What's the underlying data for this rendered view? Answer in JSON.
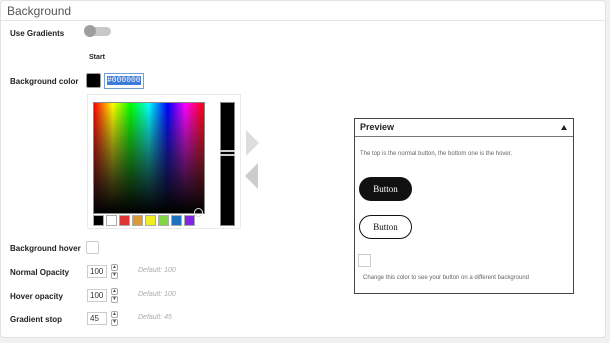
{
  "section": {
    "title": "Background"
  },
  "use_gradients": {
    "label": "Use Gradients",
    "enabled": false
  },
  "start_label": "Start",
  "background_color": {
    "label": "Background color",
    "hex": "#000000",
    "swatch_color": "#000000"
  },
  "color_picker": {
    "palette": [
      "#000000",
      "#ffffff",
      "#dd3333",
      "#dd9933",
      "#eeee22",
      "#81d742",
      "#1e73be",
      "#8224e3"
    ]
  },
  "background_hover": {
    "label": "Background hover"
  },
  "normal_opacity": {
    "label": "Normal Opacity",
    "value": "100",
    "default_hint": "Default: 100"
  },
  "hover_opacity": {
    "label": "Hover opacity",
    "value": "100",
    "default_hint": "Default: 100"
  },
  "gradient_stop": {
    "label": "Gradient stop",
    "value": "45",
    "default_hint": "Default: 45"
  },
  "preview": {
    "title": "Preview",
    "description": "The top is the normal button, the bottom one is the hover.",
    "normal_button_label": "Button",
    "hover_button_label": "Button",
    "bg_hint": "Change this color to see your button on a different background"
  },
  "icons": {
    "collapse": "caret-up-icon",
    "spin_up": "chevron-up-icon",
    "spin_down": "chevron-down-icon"
  }
}
